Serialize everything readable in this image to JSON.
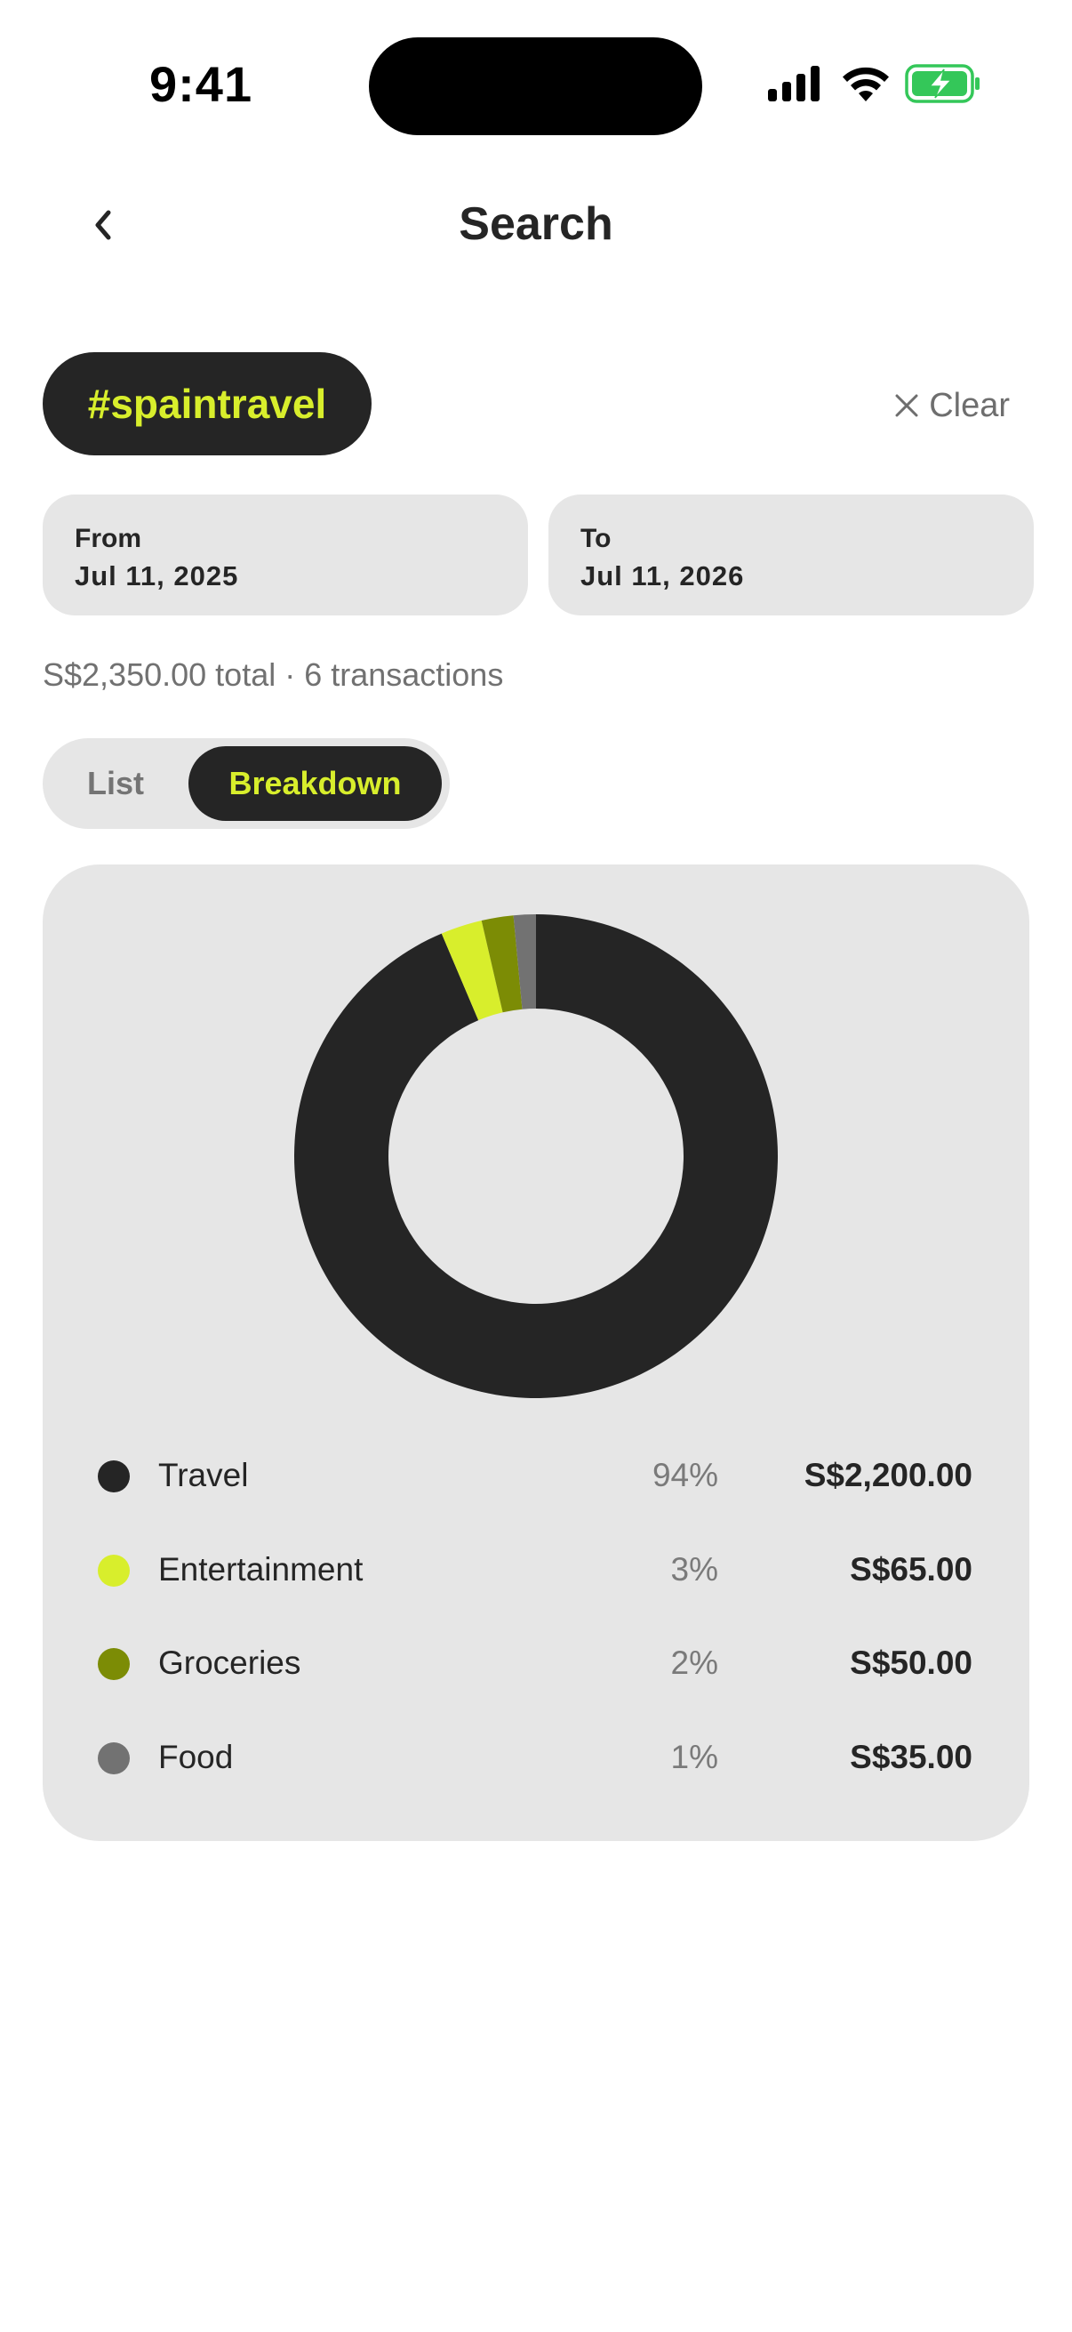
{
  "status_bar": {
    "time": "9:41",
    "icons": [
      "signal-icon",
      "wifi-icon",
      "battery-charging-icon"
    ],
    "battery_color": "#34c759"
  },
  "nav": {
    "back_icon": "chevron-left-icon",
    "title": "Search"
  },
  "filter": {
    "tag": "#spaintravel",
    "clear_label": "Clear",
    "clear_icon": "close-icon"
  },
  "date_range": {
    "from_label": "From",
    "from_value": "Jul 11, 2025",
    "to_label": "To",
    "to_value": "Jul 11, 2026"
  },
  "summary": "S$2,350.00 total · 6 transactions",
  "view_toggle": {
    "options": [
      "List",
      "Breakdown"
    ],
    "selected": "Breakdown"
  },
  "colors": {
    "accent": "#d8ee2c",
    "dark": "#252525",
    "card_bg": "#e6e6e6"
  },
  "chart_data": {
    "type": "pie",
    "style": "donut",
    "series": [
      {
        "label": "Travel",
        "percent": "94%",
        "amount": "S$2,200.00",
        "value": 2200,
        "color": "#252525"
      },
      {
        "label": "Entertainment",
        "percent": "3%",
        "amount": "S$65.00",
        "value": 65,
        "color": "#d8ee2c"
      },
      {
        "label": "Groceries",
        "percent": "2%",
        "amount": "S$50.00",
        "value": 50,
        "color": "#7c8c05"
      },
      {
        "label": "Food",
        "percent": "1%",
        "amount": "S$35.00",
        "value": 35,
        "color": "#727272"
      }
    ]
  }
}
